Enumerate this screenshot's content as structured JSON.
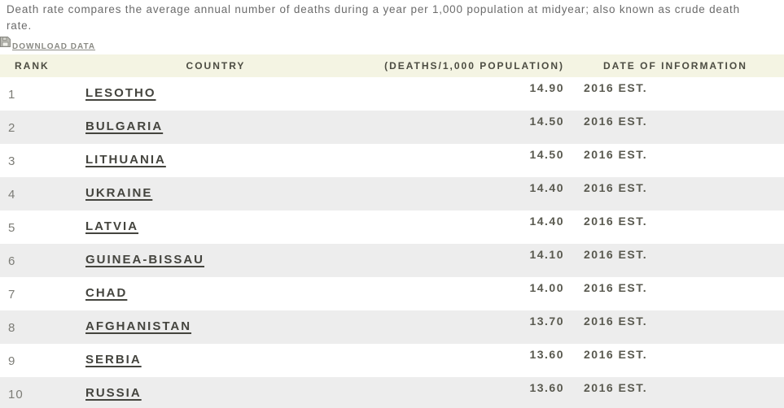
{
  "description": "Death rate compares the average annual number of deaths during a year per 1,000 population at midyear; also known as crude death rate.",
  "download": {
    "label": "DOWNLOAD DATA",
    "icon": "floppy-disk-icon"
  },
  "table": {
    "headers": {
      "rank": "RANK",
      "country": "COUNTRY",
      "value": "(DEATHS/1,000 POPULATION)",
      "date": "DATE OF INFORMATION"
    },
    "rows": [
      {
        "rank": "1",
        "country": "LESOTHO",
        "value": "14.90",
        "date": "2016 EST."
      },
      {
        "rank": "2",
        "country": "BULGARIA",
        "value": "14.50",
        "date": "2016 EST."
      },
      {
        "rank": "3",
        "country": "LITHUANIA",
        "value": "14.50",
        "date": "2016 EST."
      },
      {
        "rank": "4",
        "country": "UKRAINE",
        "value": "14.40",
        "date": "2016 EST."
      },
      {
        "rank": "5",
        "country": "LATVIA",
        "value": "14.40",
        "date": "2016 EST."
      },
      {
        "rank": "6",
        "country": "GUINEA-BISSAU",
        "value": "14.10",
        "date": "2016 EST."
      },
      {
        "rank": "7",
        "country": "CHAD",
        "value": "14.00",
        "date": "2016 EST."
      },
      {
        "rank": "8",
        "country": "AFGHANISTAN",
        "value": "13.70",
        "date": "2016 EST."
      },
      {
        "rank": "9",
        "country": "SERBIA",
        "value": "13.60",
        "date": "2016 EST."
      },
      {
        "rank": "10",
        "country": "RUSSIA",
        "value": "13.60",
        "date": "2016 EST."
      }
    ]
  },
  "colors": {
    "header_band": "#f4f4e3",
    "alt_row": "#ededed",
    "link_text": "#44443e",
    "body_text": "#6b6b6b",
    "value_text": "#59594f"
  }
}
